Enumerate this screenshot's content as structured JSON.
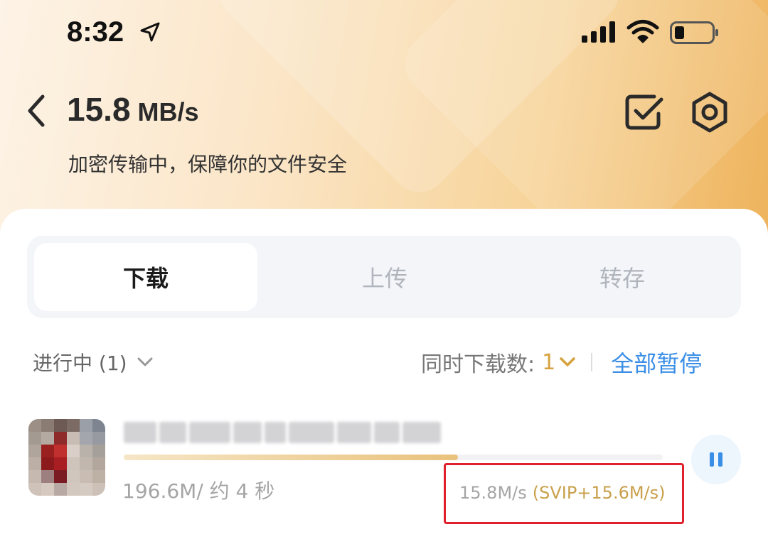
{
  "status_bar": {
    "time": "8:32",
    "icons": [
      "location-arrow-icon",
      "cellular-signal-icon",
      "wifi-icon",
      "battery-icon"
    ]
  },
  "header": {
    "speed_value": "15.8",
    "speed_unit": "MB/s",
    "subtitle": "加密传输中，保障你的文件安全",
    "icons": [
      "back-icon",
      "multi-select-icon",
      "settings-icon"
    ]
  },
  "tabs": [
    {
      "label": "下载",
      "active": true
    },
    {
      "label": "上传",
      "active": false
    },
    {
      "label": "转存",
      "active": false
    }
  ],
  "filter": {
    "label": "进行中 (1)",
    "concurrency_label": "同时下载数:",
    "concurrency_value": "1",
    "pause_all": "全部暂停"
  },
  "download_item": {
    "size_eta": "196.6M/ 约 4 秒",
    "speed": "15.8M/s",
    "svip_speed": "(SVIP+15.6M/s)",
    "progress": 0.62
  },
  "colors": {
    "accent_gold": "#d6a23e",
    "link_blue": "#3a8ee6",
    "highlight_red": "#e0212d"
  }
}
